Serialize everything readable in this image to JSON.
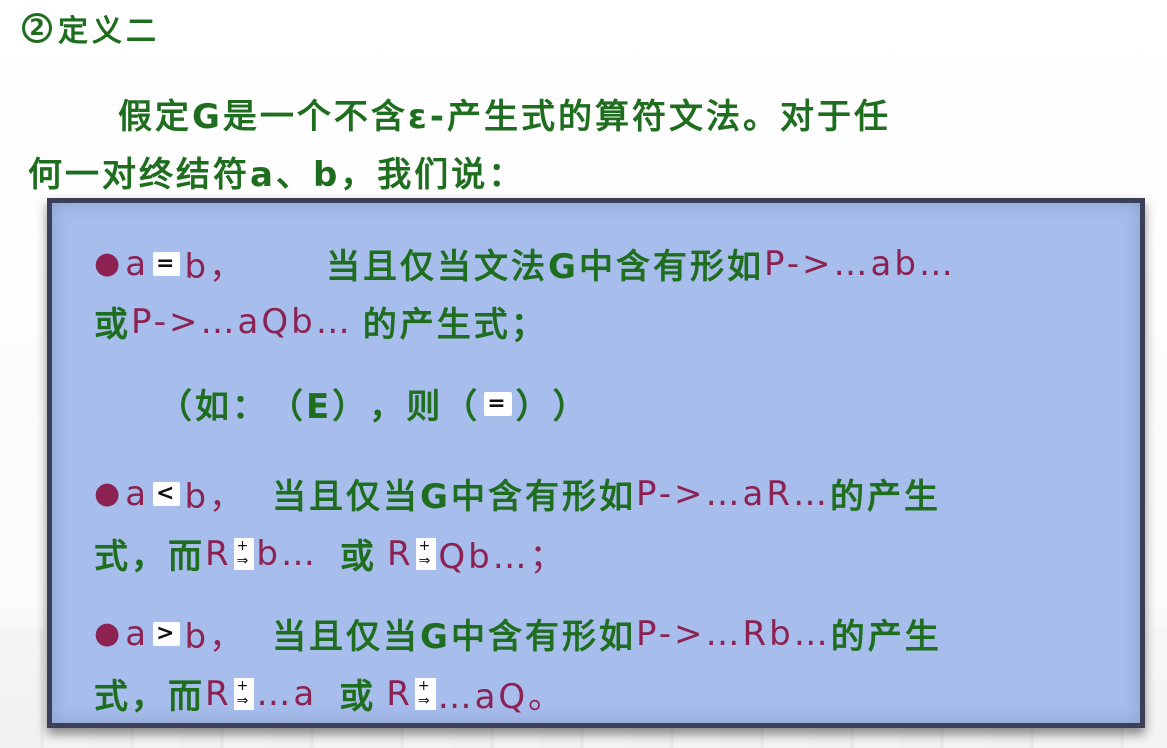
{
  "heading": {
    "number": "2",
    "title": "定义二"
  },
  "intro": {
    "line1": "假定G是一个不含ε-产生式的算符文法。对于任",
    "line2": "何一对终结符a、b，我们说："
  },
  "rules": {
    "eq": {
      "a": "a",
      "sym": "=",
      "b": "b，",
      "cond": "当且仅当文法G中含有形如",
      "prod1": "P->…ab…",
      "cont_or": "或",
      "prod2": "P->…aQb…",
      "tail": "的产生式；"
    },
    "example": {
      "open": "（如：",
      "paren_expr": "（E）",
      "comma": "，则",
      "paren_open": "（",
      "sym": "=",
      "paren_close": "）",
      "close": "）"
    },
    "lt": {
      "a": "a",
      "sym": "<",
      "b": "b，",
      "cond": "当且仅当G中含有形如",
      "prod": "P->…aR…",
      "tail1": "的产生",
      "tail2a": "式，而",
      "r1": "R",
      "deriv_top": "+",
      "deriv_arrow": "⇒",
      "seq1": "b…",
      "or": "或",
      "r2": "R",
      "seq2": "Qb…；"
    },
    "gt": {
      "a": "a",
      "sym": ">",
      "b": "b，",
      "cond": "当且仅当G中含有形如",
      "prod": "P->…Rb…",
      "tail1": "的产生",
      "tail2a": "式，而",
      "r1": "R",
      "deriv_top": "+",
      "deriv_arrow": "⇒",
      "seq1": "…a",
      "or": "或",
      "r2": "R",
      "seq2": "…aQ。"
    }
  },
  "colors": {
    "green": "#1f6e1f",
    "maroon": "#8b2252",
    "panel": "#a7bdec"
  }
}
